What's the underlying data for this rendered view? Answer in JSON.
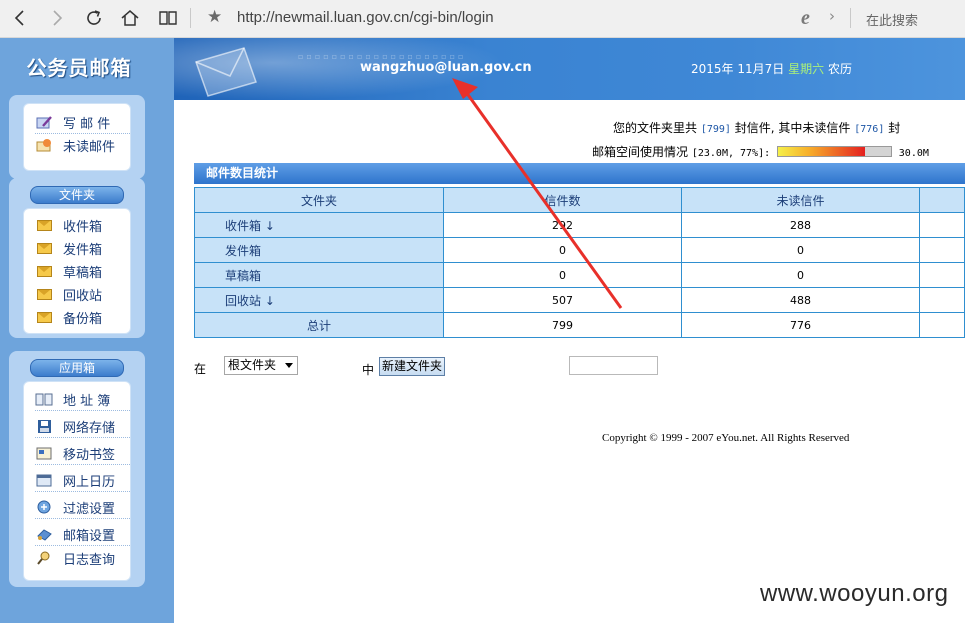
{
  "browser": {
    "url": "http://newmail.luan.gov.cn/cgi-bin/login",
    "search_placeholder": "在此搜索"
  },
  "sidebar": {
    "logo": "公务员邮箱",
    "compose": [
      {
        "label": "写 邮 件",
        "icon": "compose-icon"
      },
      {
        "label": "未读邮件",
        "icon": "unread-mail-icon"
      }
    ],
    "folders_title": "文件夹",
    "folders": [
      {
        "label": "收件箱",
        "icon": "envelope-icon"
      },
      {
        "label": "发件箱",
        "icon": "envelope-icon"
      },
      {
        "label": "草稿箱",
        "icon": "envelope-icon"
      },
      {
        "label": "回收站",
        "icon": "envelope-icon"
      },
      {
        "label": "备份箱",
        "icon": "envelope-icon"
      }
    ],
    "apps_title": "应用箱",
    "apps": [
      {
        "label": "地 址 簿",
        "icon": "address-book-icon"
      },
      {
        "label": "网络存储",
        "icon": "disk-icon"
      },
      {
        "label": "移动书签",
        "icon": "bookmark-icon"
      },
      {
        "label": "网上日历",
        "icon": "calendar-icon"
      },
      {
        "label": "过滤设置",
        "icon": "filter-icon"
      },
      {
        "label": "邮箱设置",
        "icon": "settings-icon"
      },
      {
        "label": "日志查询",
        "icon": "log-search-icon"
      }
    ]
  },
  "header": {
    "user_email": "wangzhuo@luan.gov.cn",
    "date": "2015年  11月7日",
    "weekday": "星期六",
    "calendar": "农历"
  },
  "stats": {
    "line1_prefix": "您的文件夹里共",
    "total": "[799]",
    "line1_mid": "封信件, 其中未读信件",
    "unread": "[776]",
    "line1_suffix": "封",
    "line2_prefix": "邮箱空间使用情况",
    "usage": "[23.0M, 77%]:",
    "usage_fraction": 0.77,
    "capacity": "30.0M"
  },
  "table": {
    "title": "邮件数目统计",
    "headers": [
      "文件夹",
      "信件数",
      "未读信件"
    ],
    "rows": [
      {
        "folder": "收件箱",
        "arrow": "↓",
        "count": "292",
        "unread": "288"
      },
      {
        "folder": "发件箱",
        "arrow": "",
        "count": "0",
        "unread": "0"
      },
      {
        "folder": "草稿箱",
        "arrow": "",
        "count": "0",
        "unread": "0"
      },
      {
        "folder": "回收站",
        "arrow": "↓",
        "count": "507",
        "unread": "488"
      }
    ],
    "total_label": "总计",
    "total_count": "799",
    "total_unread": "776"
  },
  "folder_form": {
    "in_label": "在",
    "select_value": "根文件夹",
    "mid_label": "中",
    "button_label": "新建文件夹"
  },
  "footer": {
    "copyright": "Copyright © 1999 - 2007 eYou.net. All Rights Reserved"
  },
  "watermark": "www.wooyun.org",
  "colors": {
    "sidebar_bg": "#6ea4dc",
    "banner_bg": "#2f74c8",
    "annotation_arrow": "#e8302a"
  }
}
